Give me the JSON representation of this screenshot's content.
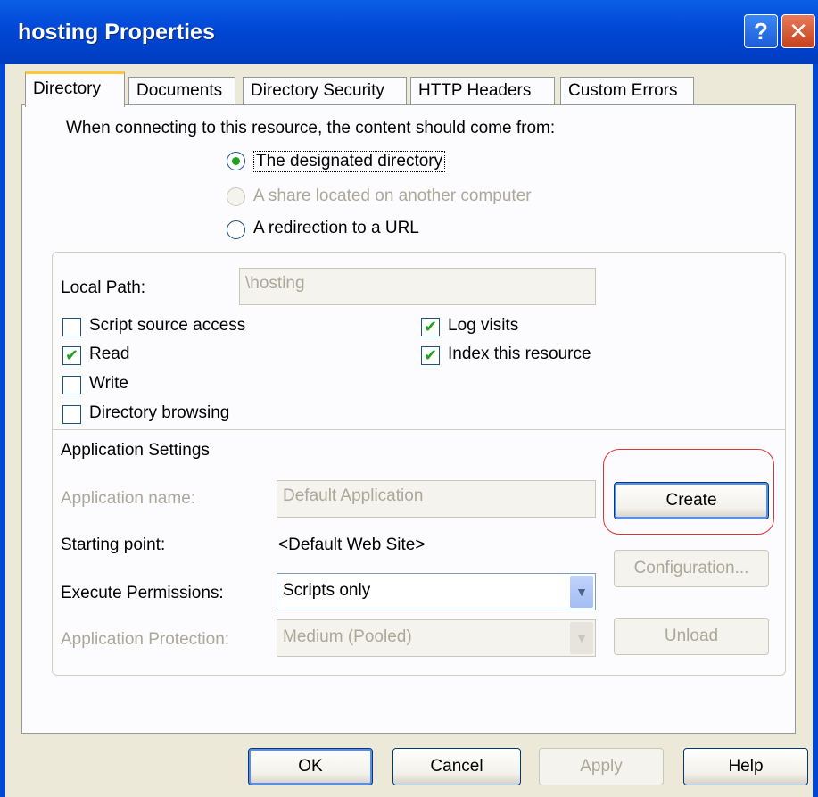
{
  "window": {
    "title": "hosting Properties"
  },
  "titlebar": {
    "help_glyph": "?",
    "close_glyph": "✕"
  },
  "tabs": [
    "Directory",
    "Documents",
    "Directory Security",
    "HTTP Headers",
    "Custom Errors"
  ],
  "content_source": {
    "prompt": "When connecting to this resource, the content should come from:",
    "options": [
      {
        "label": "The designated directory",
        "checked": true,
        "enabled": true
      },
      {
        "label": "A share located on another computer",
        "checked": false,
        "enabled": false
      },
      {
        "label": "A redirection to a URL",
        "checked": false,
        "enabled": true
      }
    ]
  },
  "local_path": {
    "label": "Local Path:",
    "value": "\\hosting"
  },
  "permissions_left": [
    {
      "label": "Script source access",
      "checked": false
    },
    {
      "label": "Read",
      "checked": true
    },
    {
      "label": "Write",
      "checked": false
    },
    {
      "label": "Directory browsing",
      "checked": false
    }
  ],
  "permissions_right": [
    {
      "label": "Log visits",
      "checked": true
    },
    {
      "label": "Index this resource",
      "checked": true
    }
  ],
  "app_settings": {
    "heading": "Application Settings",
    "app_name_label": "Application name:",
    "app_name_value": "Default Application",
    "starting_point_label": "Starting point:",
    "starting_point_value": "<Default Web Site>",
    "exec_perm_label": "Execute Permissions:",
    "exec_perm_value": "Scripts only",
    "app_protection_label": "Application Protection:",
    "app_protection_value": "Medium (Pooled)",
    "create_label": "Create",
    "configuration_label": "Configuration...",
    "unload_label": "Unload"
  },
  "footer": {
    "ok": "OK",
    "cancel": "Cancel",
    "apply": "Apply",
    "help": "Help"
  },
  "colors": {
    "title_bar": "#0047d6",
    "check": "#21a121",
    "highlight": "#e33232",
    "tab_accent": "#ffc83c"
  }
}
